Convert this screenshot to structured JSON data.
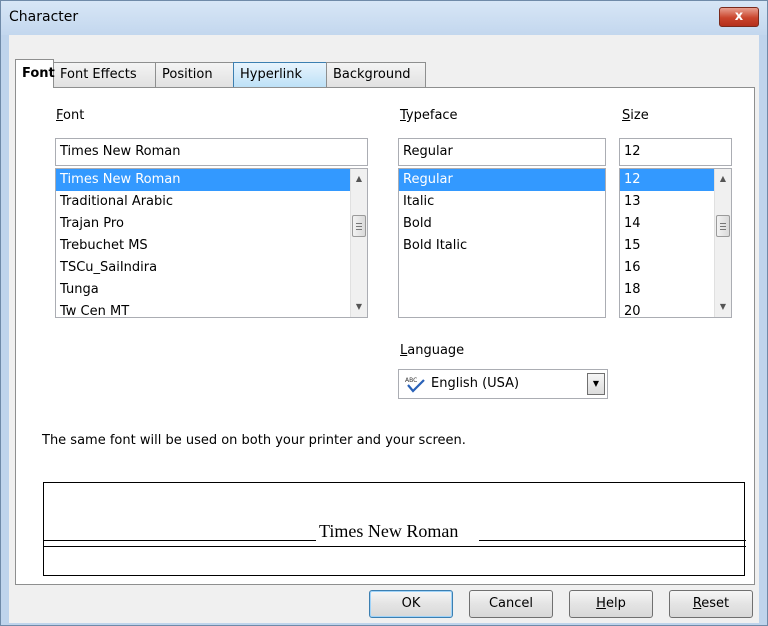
{
  "window": {
    "title": "Character",
    "close_label": "x"
  },
  "tabs": [
    {
      "label": "Font",
      "active": true
    },
    {
      "label": "Font Effects"
    },
    {
      "label": "Position"
    },
    {
      "label": "Hyperlink",
      "hover": true
    },
    {
      "label": "Background"
    }
  ],
  "font": {
    "label_first": "F",
    "label_rest": "ont",
    "value": "Times New Roman",
    "items": [
      "Times New Roman",
      "Traditional Arabic",
      "Trajan Pro",
      "Trebuchet MS",
      "TSCu_SaiIndira",
      "Tunga",
      "Tw Cen MT"
    ],
    "selected_index": 0
  },
  "typeface": {
    "label_first": "T",
    "label_rest": "ypeface",
    "value": "Regular",
    "items": [
      "Regular",
      "Italic",
      "Bold",
      "Bold Italic"
    ],
    "selected_index": 0
  },
  "size": {
    "label_first": "S",
    "label_rest": "ize",
    "value": "12",
    "items": [
      "12",
      "13",
      "14",
      "15",
      "16",
      "18",
      "20"
    ],
    "selected_index": 0
  },
  "language": {
    "label_first": "L",
    "label_rest": "anguage",
    "value": "English (USA)",
    "icon": "spellcheck-icon"
  },
  "info_text": "The same font will be used on both your printer and your screen.",
  "preview": {
    "text": "Times New Roman"
  },
  "buttons": {
    "ok": "OK",
    "cancel": "Cancel",
    "help_first": "H",
    "help_rest": "elp",
    "reset_first": "R",
    "reset_rest": "eset"
  },
  "colors": {
    "selection": "#3399ff",
    "close_button": "#c9442c",
    "title_bar": "#c3d7ee"
  }
}
